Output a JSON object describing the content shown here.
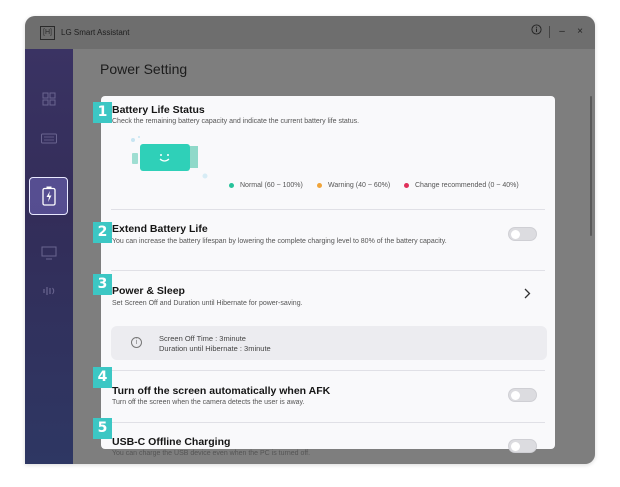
{
  "titlebar": {
    "logo": "[H]",
    "app_title": "LG Smart Assistant",
    "info_icon": "info-icon",
    "minimize": "–",
    "close": "×"
  },
  "sidebar": {
    "items": [
      {
        "icon": "apps-icon",
        "active": false
      },
      {
        "icon": "keyboard-icon",
        "active": false
      },
      {
        "icon": "battery-icon",
        "active": true
      },
      {
        "icon": "monitor-icon",
        "active": false
      },
      {
        "icon": "sound-icon",
        "active": false
      }
    ]
  },
  "page": {
    "title": "Power Setting"
  },
  "sections": {
    "battery_status": {
      "badge": "1",
      "title": "Battery Life Status",
      "desc": "Check the remaining battery capacity and indicate the current battery life status.",
      "legend": [
        {
          "label": "Normal (60 ~ 100%)",
          "color": "#27c29a"
        },
        {
          "label": "Warning (40 ~ 60%)",
          "color": "#f0a43a"
        },
        {
          "label": "Change recommended (0 ~ 40%)",
          "color": "#e0305a"
        }
      ]
    },
    "extend_battery": {
      "badge": "2",
      "title": "Extend Battery Life",
      "desc": "You can increase the battery lifespan by lowering the complete charging level to 80% of the battery capacity.",
      "toggle_on": false
    },
    "power_sleep": {
      "badge": "3",
      "title": "Power & Sleep",
      "desc": "Set Screen Off and Duration until Hibernate for power-saving.",
      "info_lines": [
        "Screen Off Time  : 3minute",
        "Duration until Hibernate  : 3minute"
      ]
    },
    "afk": {
      "badge": "4",
      "title": "Turn off the screen automatically when AFK",
      "desc": "Turn off the screen when the camera detects the user is away.",
      "toggle_on": false
    },
    "usbc": {
      "badge": "5",
      "title": "USB-C Offline Charging",
      "desc": "You can charge the USB device even when the PC is turned off.",
      "toggle_on": false
    }
  },
  "colors": {
    "badge": "#3cc7c4",
    "battery": "#2fd0b8"
  }
}
